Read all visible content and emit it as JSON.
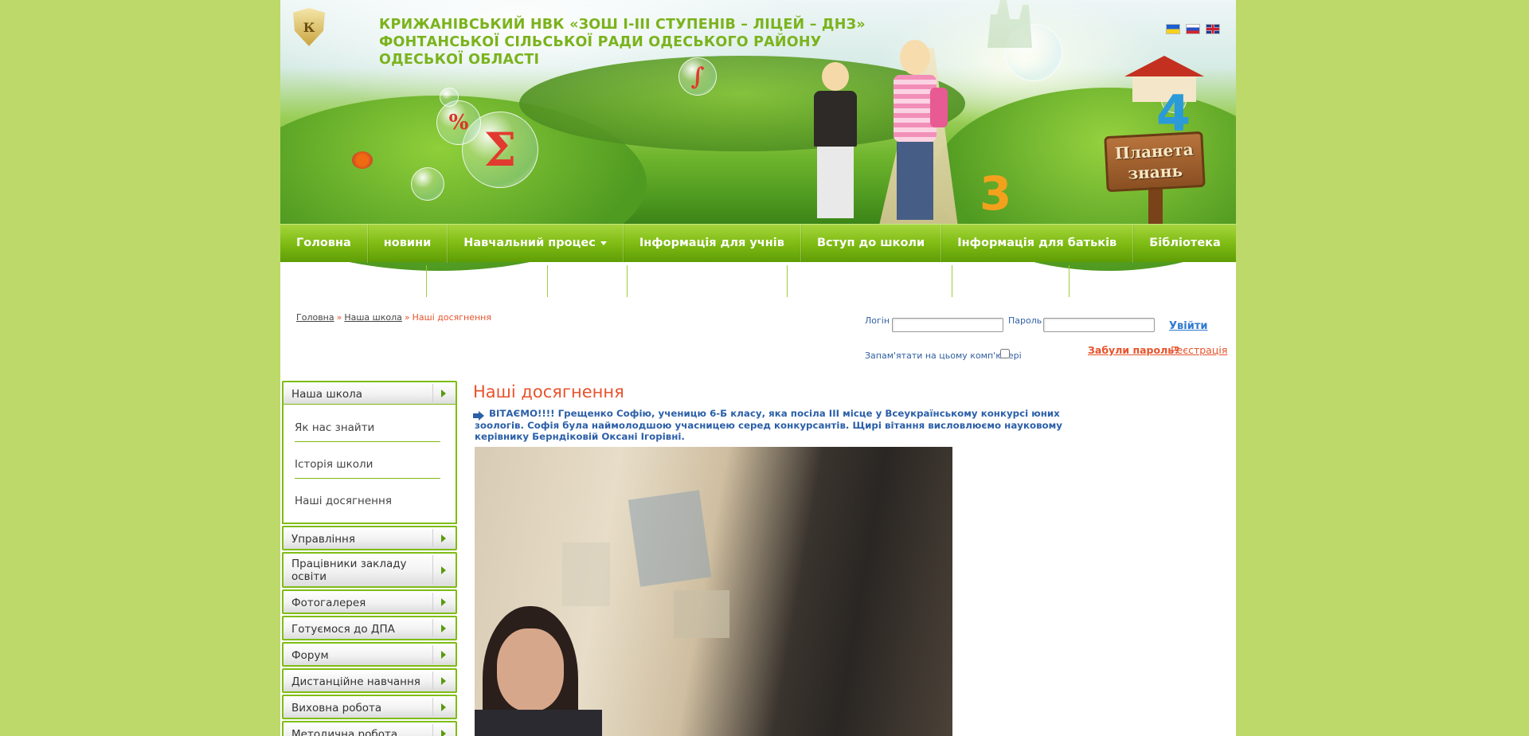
{
  "header": {
    "site_title": "КРИЖАНІВСЬКИЙ НВК «ЗОШ І-ІІІ СТУПЕНІВ – ЛІЦЕЙ – ДНЗ» ФОНТАНСЬКОЇ СІЛЬСЬКОЇ РАДИ ОДЕСЬКОГО РАЙОНУ ОДЕСЬКОЇ ОБЛАСТІ",
    "logo_letter": "К",
    "sign_text": "Планета знань",
    "bubble_symbols": [
      "Σ",
      "%",
      "∫",
      "3"
    ],
    "languages": [
      {
        "name": "ukrainian-flag",
        "colors": [
          "#1c5fcf",
          "#f6d21c"
        ]
      },
      {
        "name": "russian-flag",
        "colors": [
          "#ffffff",
          "#2a4fc1",
          "#d6262b"
        ]
      },
      {
        "name": "english-flag",
        "colors": [
          "#1f3a8a",
          "#ffffff",
          "#cf1f2e"
        ]
      }
    ]
  },
  "nav": {
    "items": [
      {
        "label": "Головна"
      },
      {
        "label": "новини"
      },
      {
        "label": "Навчальний процес",
        "has_dropdown": true
      },
      {
        "label": "Інформація для учнів"
      },
      {
        "label": "Вступ до школи"
      },
      {
        "label": "Інформація для батьків"
      },
      {
        "label": "Бібліотека"
      }
    ]
  },
  "breadcrumb": {
    "home": "Головна",
    "section": "Наша школа",
    "current": "Наші досягнення",
    "separator": "»"
  },
  "login": {
    "login_label": "Логін",
    "password_label": "Пароль",
    "submit_label": "Увійти",
    "remember_label": "Запам'ятати на цьому комп'ютері",
    "forgot_label": "Забули пароль?",
    "register_label": "Реєстрація"
  },
  "sidebar": {
    "open_section": {
      "label": "Наша школа",
      "children": [
        "Як нас знайти",
        "Історія школи",
        "Наші досягнення"
      ]
    },
    "items": [
      "Управління",
      "Працівники закладу освіти",
      "Фотогалерея",
      "Готуємося до ДПА",
      "Форум",
      "Дистанційне навчання",
      "Виховна робота",
      "Методична робота"
    ]
  },
  "article": {
    "title": "Наші досягнення",
    "intro_text": "ВІТАЄМО!!!! Грещенко Софію, ученицю 6-Б класу, яка посіла ІІІ місце у Всеукраїнському конкурсі юних зоологів. Софія була наймолодшою учасницею серед конкурсантів. Щирі вітання висловлюємо науковому керівнику Берндіковій Оксані Ігорівні."
  },
  "colors": {
    "page_bg": "#bcd96a",
    "accent_green": "#7fbc14",
    "title_orange": "#e8532c",
    "link_blue": "#2b5fa8"
  }
}
